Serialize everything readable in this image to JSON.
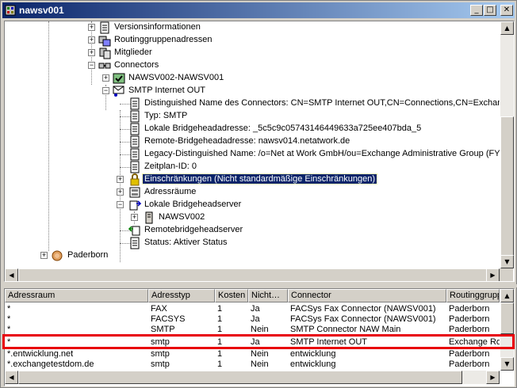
{
  "window": {
    "title": "nawsv001"
  },
  "titlebar_buttons": {
    "minimize": "_",
    "maximize": "□",
    "close": "✕"
  },
  "tree": {
    "nodes": [
      {
        "label": "Versionsinformationen",
        "icon": "properties-icon"
      },
      {
        "label": "Routinggruppenadressen",
        "icon": "routing-address-icon"
      },
      {
        "label": "Mitglieder",
        "icon": "members-icon"
      },
      {
        "label": "Connectors",
        "icon": "connectors-icon"
      },
      {
        "label": "NAWSV002-NAWSV001",
        "icon": "connector-icon"
      },
      {
        "label": "SMTP Internet OUT",
        "icon": "smtp-connector-icon"
      },
      {
        "label": "Distinguished Name des Connectors: CN=SMTP Internet OUT,CN=Connections,CN=Exchange",
        "icon": "property-icon"
      },
      {
        "label": "Typ: SMTP",
        "icon": "property-icon"
      },
      {
        "label": "Lokale Bridgeheadadresse: _5c5c9c05743146449633a725ee407bda_5",
        "icon": "property-icon"
      },
      {
        "label": "Remote-Bridgeheadadresse: nawsv014.netatwork.de",
        "icon": "property-icon"
      },
      {
        "label": "Legacy-Distinguished Name: /o=Net at Work GmbH/ou=Exchange Administrative Group (FYDIE",
        "icon": "property-icon"
      },
      {
        "label": "Zeitplan-ID: 0",
        "icon": "property-icon"
      },
      {
        "label": "Einschränkungen  (Nicht standardmäßige Einschränkungen)",
        "icon": "lock-icon"
      },
      {
        "label": "Adressräume",
        "icon": "address-space-icon"
      },
      {
        "label": "Lokale Bridgeheadserver",
        "icon": "bridgehead-icon"
      },
      {
        "label": "NAWSV002",
        "icon": "server-icon"
      },
      {
        "label": "Remotebridgeheadserver",
        "icon": "remote-bridgehead-icon"
      },
      {
        "label": "Status: Aktiver Status",
        "icon": "property-icon"
      },
      {
        "label": "Paderborn",
        "icon": "site-icon"
      }
    ]
  },
  "list": {
    "columns": [
      "Adressraum",
      "Adresstyp",
      "Kosten",
      "Nicht…",
      "Connector",
      "Routinggrupp"
    ],
    "rows": [
      [
        "*",
        "FAX",
        "1",
        "Ja",
        "FACSys Fax Connector (NAWSV001)",
        "Paderborn"
      ],
      [
        "*",
        "FACSYS",
        "1",
        "Ja",
        "FACSys Fax Connector (NAWSV001)",
        "Paderborn"
      ],
      [
        "*",
        "SMTP",
        "1",
        "Nein",
        "SMTP Connector NAW Main",
        "Paderborn"
      ],
      [
        "*",
        "smtp",
        "1",
        "Ja",
        "SMTP Internet OUT",
        "Exchange Ro"
      ],
      [
        "*.entwicklung.net",
        "smtp",
        "1",
        "Nein",
        "entwicklung",
        "Paderborn"
      ],
      [
        "*.exchangetestdom.de",
        "smtp",
        "1",
        "Nein",
        "entwicklung",
        "Paderborn"
      ]
    ],
    "highlighted_row": 3
  },
  "colors": {
    "selection": "#0a246a",
    "highlight_box": "#e8000c",
    "titlebar_start": "#0a246a",
    "titlebar_end": "#a6caf0"
  }
}
